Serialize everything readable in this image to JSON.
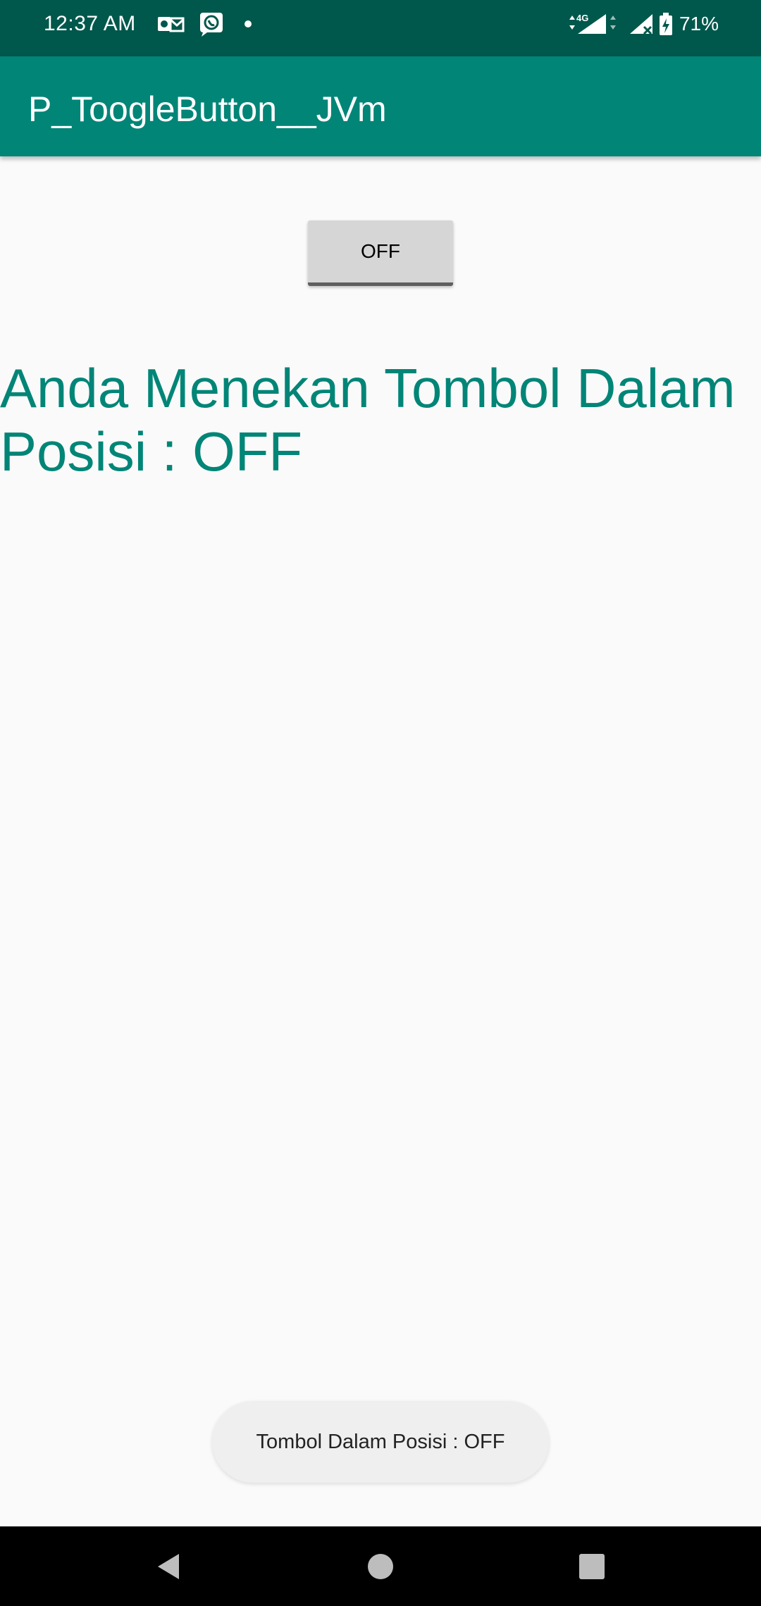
{
  "status_bar": {
    "time": "12:37 AM",
    "battery_percent": "71%",
    "icons": [
      "outlook-notification-icon",
      "whatsapp-notification-icon",
      "notification-dot-icon",
      "4g-signal-icon",
      "signal-no-service-icon",
      "battery-charging-icon"
    ]
  },
  "app_bar": {
    "title": "P_ToogleButton__JVm"
  },
  "main": {
    "toggle_label": "OFF",
    "result_text": "Anda Menekan Tombol Dalam Posisi : OFF"
  },
  "toast": {
    "message": "Tombol Dalam Posisi : OFF"
  },
  "nav_bar": {
    "buttons": [
      "back-icon",
      "home-icon",
      "recents-icon"
    ]
  },
  "colors": {
    "status_bar": "#00574b",
    "app_bar": "#008577",
    "accent_text": "#008577",
    "background": "#fafafa",
    "toggle_bg": "#d6d6d6",
    "toast_bg": "#efefef",
    "nav_bar": "#000000"
  }
}
